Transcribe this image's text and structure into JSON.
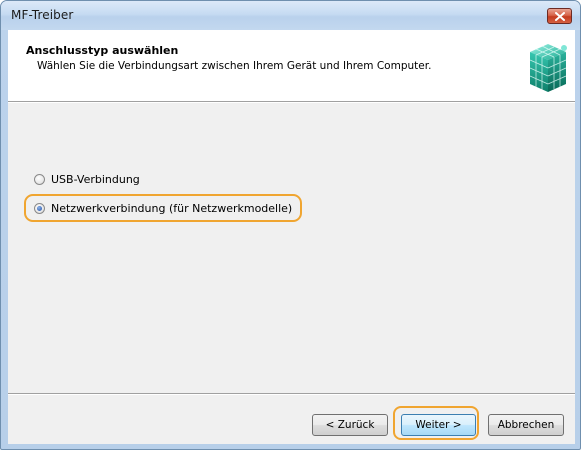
{
  "window": {
    "title": "MF-Treiber"
  },
  "header": {
    "title": "Anschlusstyp auswählen",
    "subtitle": "Wählen Sie die Verbindungsart zwischen Ihrem Gerät und Ihrem Computer.",
    "icon": "network-cube-icon"
  },
  "options": [
    {
      "label": "USB-Verbindung",
      "selected": false
    },
    {
      "label": "Netzwerkverbindung (für Netzwerkmodelle)",
      "selected": true
    }
  ],
  "buttons": {
    "back_label": "< Zurück",
    "next_label": "Weiter >",
    "cancel_label": "Abbrechen"
  },
  "colors": {
    "highlight": "#f0a530",
    "close_button": "#c43b1f"
  }
}
